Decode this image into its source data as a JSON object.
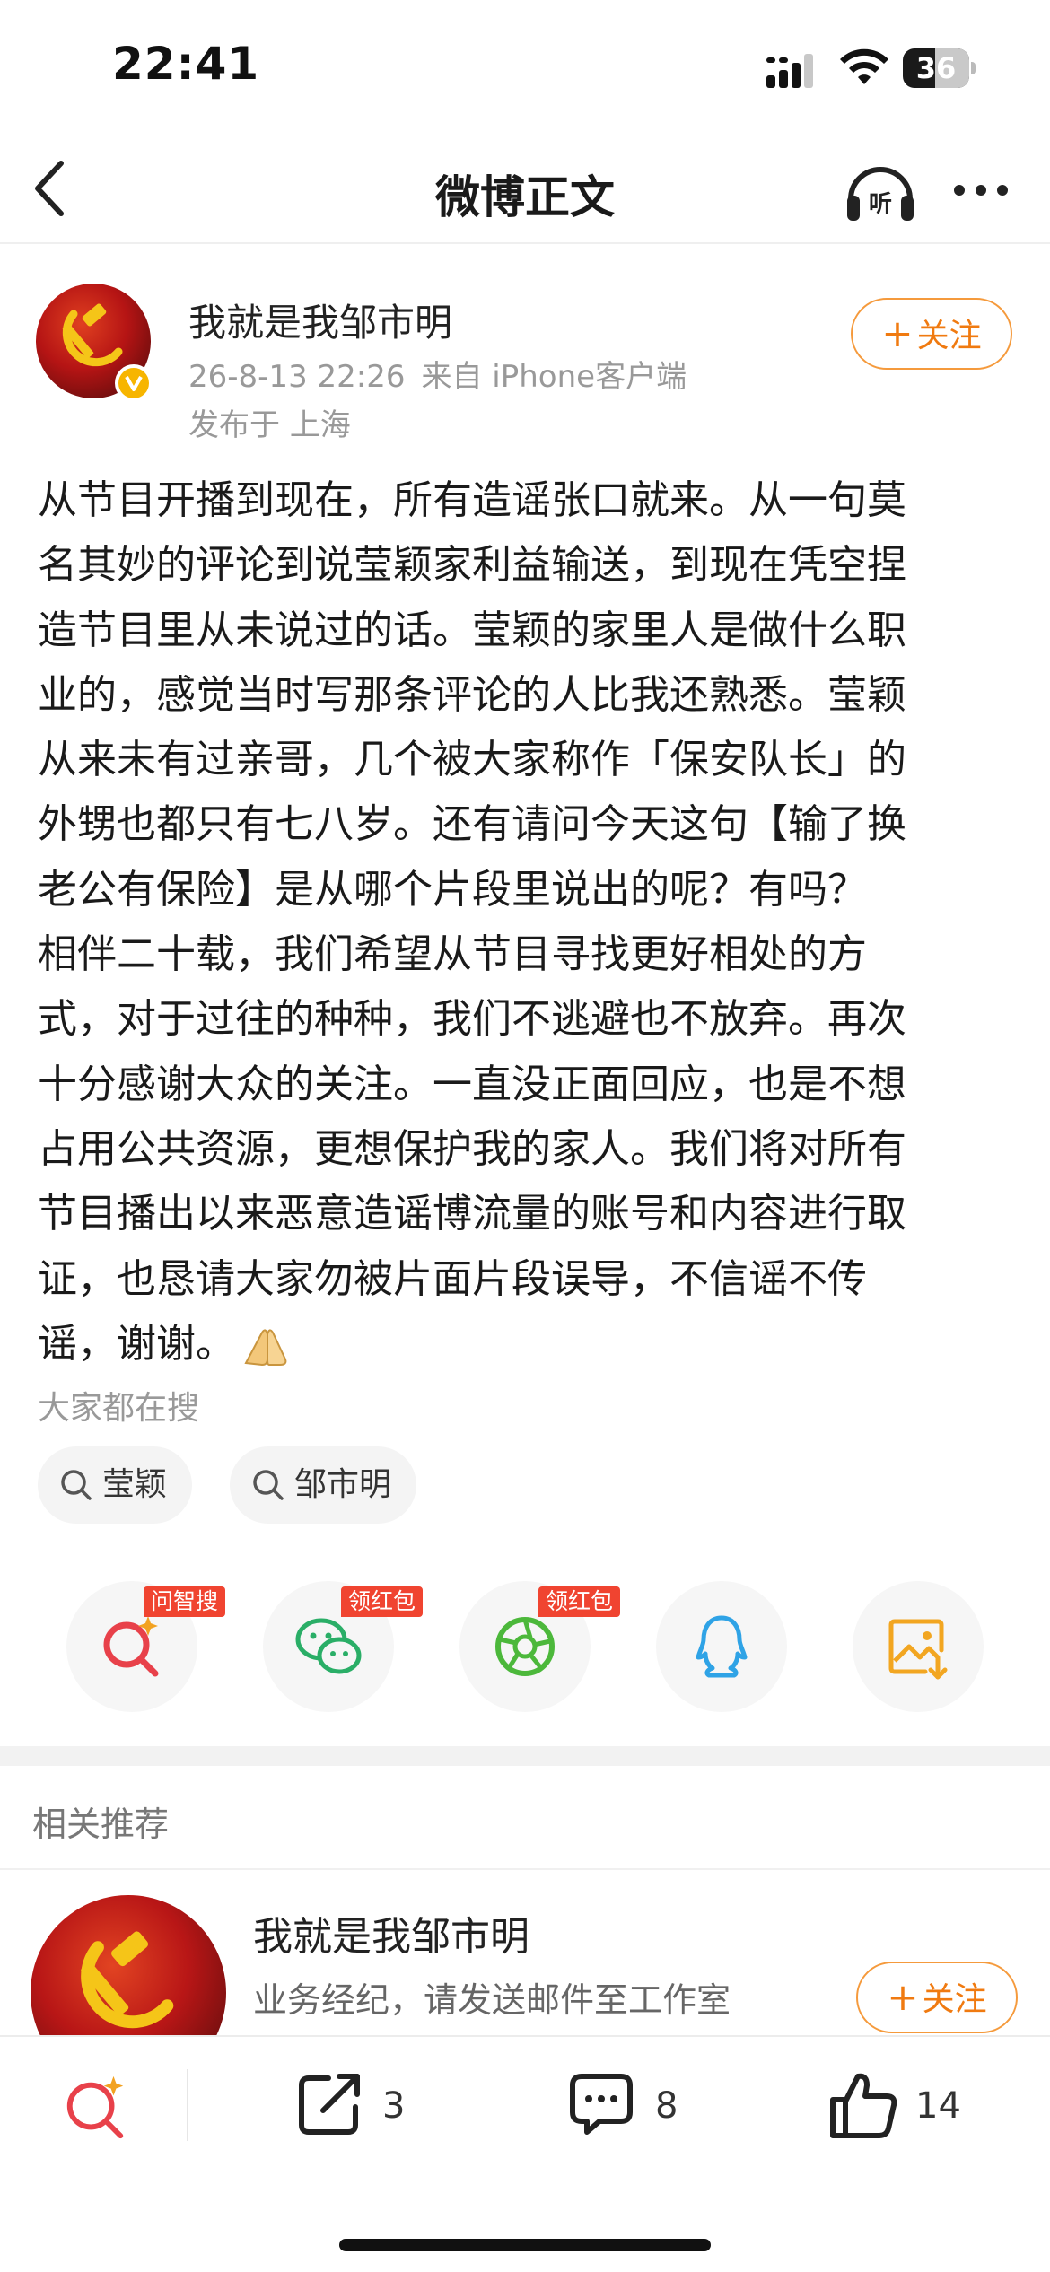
{
  "status_bar": {
    "time": "22:41",
    "battery": "36"
  },
  "nav": {
    "title": "微博正文"
  },
  "post": {
    "author": "我就是我邹市明",
    "date": "26-8-13 22:26",
    "source": "来自 iPhone客户端",
    "location": "发布于 上海",
    "follow_label": "关注",
    "body_lines": [
      "从节目开播到现在，所有造谣张口就来。从一句莫",
      "名其妙的评论到说莹颖家利益输送，到现在凭空捏",
      "造节目里从未说过的话。莹颖的家里人是做什么职",
      "业的，感觉当时写那条评论的人比我还熟悉。莹颖",
      "从来未有过亲哥，几个被大家称作「保安队长」的",
      "外甥也都只有七八岁。还有请问今天这句【输了换",
      "老公有保险】是从哪个片段里说出的呢？有吗？",
      "相伴二十载，我们希望从节目寻找更好相处的方",
      "式，对于过往的种种，我们不逃避也不放弃。再次",
      "十分感谢大众的关注。一直没正面回应，也是不想",
      "占用公共资源，更想保护我的家人。我们将对所有",
      "节目播出以来恶意造谣博流量的账号和内容进行取",
      "证，也恳请大家勿被片面片段误导，不信谣不传",
      "谣，谢谢。"
    ]
  },
  "searches": {
    "label": "大家都在搜",
    "items": [
      "莹颖",
      "邹市明"
    ]
  },
  "share": {
    "items": [
      {
        "icon": "ai-search-icon",
        "badge": "问智搜"
      },
      {
        "icon": "wechat-icon",
        "badge": "领红包"
      },
      {
        "icon": "moments-icon",
        "badge": "领红包"
      },
      {
        "icon": "qq-icon",
        "badge": ""
      },
      {
        "icon": "save-image-icon",
        "badge": ""
      }
    ]
  },
  "related": {
    "title": "相关推荐",
    "user": {
      "name": "我就是我邹市明",
      "desc": "业务经纪，请发送邮件至工作室",
      "follow_label": "关注"
    }
  },
  "bottom_bar": {
    "reposts": "3",
    "comments": "8",
    "likes": "14"
  },
  "colors": {
    "accent_orange": "#f07a10",
    "badge_red": "#f04430",
    "wechat_green": "#2aae67",
    "qq_blue": "#2fa3e6"
  }
}
